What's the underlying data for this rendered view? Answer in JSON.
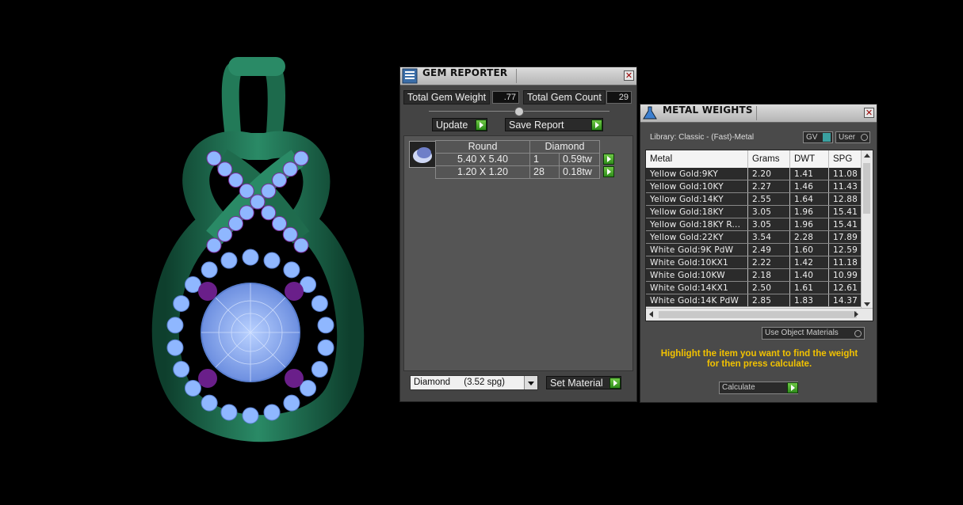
{
  "gem_reporter": {
    "title": "GEM REPORTER",
    "close": "✕",
    "total_gem_weight_label": "Total Gem Weight",
    "total_gem_weight_value": ".77",
    "total_gem_count_label": "Total Gem Count",
    "total_gem_count_value": "29",
    "update_label": "Update",
    "save_report_label": "Save Report",
    "header": {
      "shape": "Round",
      "stone": "Diamond"
    },
    "rows": [
      {
        "size": "5.40 X 5.40",
        "count": "1",
        "weight": "0.59tw"
      },
      {
        "size": "1.20 X 1.20",
        "count": "28",
        "weight": "0.18tw"
      }
    ],
    "material_select": {
      "name": "Diamond",
      "spg": "(3.52 spg)"
    },
    "set_material_label": "Set Material"
  },
  "metal_weights": {
    "title": "METAL WEIGHTS",
    "close": "✕",
    "library": "Library: Classic - (Fast)-Metal",
    "gv_label": "GV",
    "user_label": "User",
    "columns": [
      "Metal",
      "Grams",
      "DWT",
      "SPG"
    ],
    "rows": [
      [
        "Yellow Gold:9KY",
        "2.20",
        "1.41",
        "11.08"
      ],
      [
        "Yellow Gold:10KY",
        "2.27",
        "1.46",
        "11.43"
      ],
      [
        "Yellow Gold:14KY",
        "2.55",
        "1.64",
        "12.88"
      ],
      [
        "Yellow Gold:18KY",
        "3.05",
        "1.96",
        "15.41"
      ],
      [
        "Yellow Gold:18KY R...",
        "3.05",
        "1.96",
        "15.41"
      ],
      [
        "Yellow Gold:22KY",
        "3.54",
        "2.28",
        "17.89"
      ],
      [
        "White Gold:9K PdW",
        "2.49",
        "1.60",
        "12.59"
      ],
      [
        "White Gold:10KX1",
        "2.22",
        "1.42",
        "11.18"
      ],
      [
        "White Gold:10KW",
        "2.18",
        "1.40",
        "10.99"
      ],
      [
        "White Gold:14KX1",
        "2.50",
        "1.61",
        "12.61"
      ],
      [
        "White Gold:14K PdW",
        "2.85",
        "1.83",
        "14.37"
      ]
    ],
    "use_object_materials": "Use Object Materials",
    "instruction": "Highlight the item you want to find the weight for then press calculate.",
    "calculate_label": "Calculate"
  },
  "colors": {
    "metal": "#1f6b4d",
    "gem": "#8fb7ff",
    "accent_gem": "#7a2a9a",
    "instruction": "#f2c200"
  }
}
